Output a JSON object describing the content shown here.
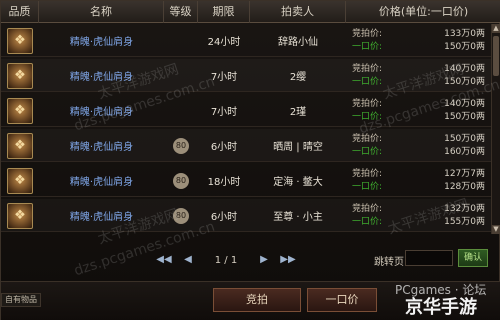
{
  "header": {
    "quality": "品质",
    "name": "名称",
    "level": "等级",
    "duration": "期限",
    "seller": "拍卖人",
    "price": "价格(单位:一口价)"
  },
  "rows": [
    {
      "icon": "beast-figure-icon",
      "name": "精魄·虎仙肩身",
      "level": "",
      "time": "24小时",
      "seller": "辞路小仙",
      "bid_label": "竞拍价:",
      "bid_value": "133万0两",
      "fixed_label": "一口价:",
      "fixed_value": "150万0两"
    },
    {
      "icon": "beast-figure-icon",
      "name": "精魄·虎仙肩身",
      "level": "",
      "time": "7小时",
      "seller": "2缨",
      "bid_label": "竞拍价:",
      "bid_value": "140万0两",
      "fixed_label": "一口价:",
      "fixed_value": "150万0两"
    },
    {
      "icon": "beast-figure-icon",
      "name": "精魄·虎仙肩身",
      "level": "",
      "time": "7小时",
      "seller": "2瑾",
      "bid_label": "竞拍价:",
      "bid_value": "140万0两",
      "fixed_label": "一口价:",
      "fixed_value": "150万0两"
    },
    {
      "icon": "beast-figure-icon",
      "name": "精魄·虎仙肩身",
      "level": "80",
      "time": "6小时",
      "seller": "晒周 | 晴空",
      "bid_label": "竞拍价:",
      "bid_value": "150万0两",
      "fixed_label": "一口价:",
      "fixed_value": "160万0两"
    },
    {
      "icon": "beast-figure-icon",
      "name": "精魄·虎仙肩身",
      "level": "80",
      "time": "18小时",
      "seller": "定海 · 鳖大",
      "bid_label": "竞拍价:",
      "bid_value": "127万7两",
      "fixed_label": "一口价:",
      "fixed_value": "128万0两"
    },
    {
      "icon": "beast-figure-icon",
      "name": "精魄·虎仙肩身",
      "level": "80",
      "time": "6小时",
      "seller": "至尊 · 小主",
      "bid_label": "竞拍价:",
      "bid_value": "132万0两",
      "fixed_label": "一口价:",
      "fixed_value": "155万0两"
    }
  ],
  "pager": {
    "page": "1 / 1",
    "prev_first": "◀◀",
    "prev": "◀",
    "next": "▶",
    "next_last": "▶▶"
  },
  "jump": {
    "label": "跳转页",
    "placeholder": "",
    "confirm": "确认"
  },
  "buttons": {
    "bid": "竞拍",
    "fixed": "一口价"
  },
  "left_tag": "自有物品",
  "watermarks": [
    "太平洋游戏网",
    "dzs.pcgames.com.cn"
  ],
  "logo": {
    "line1": "PCgames · 论坛",
    "line2": "京华手游"
  }
}
